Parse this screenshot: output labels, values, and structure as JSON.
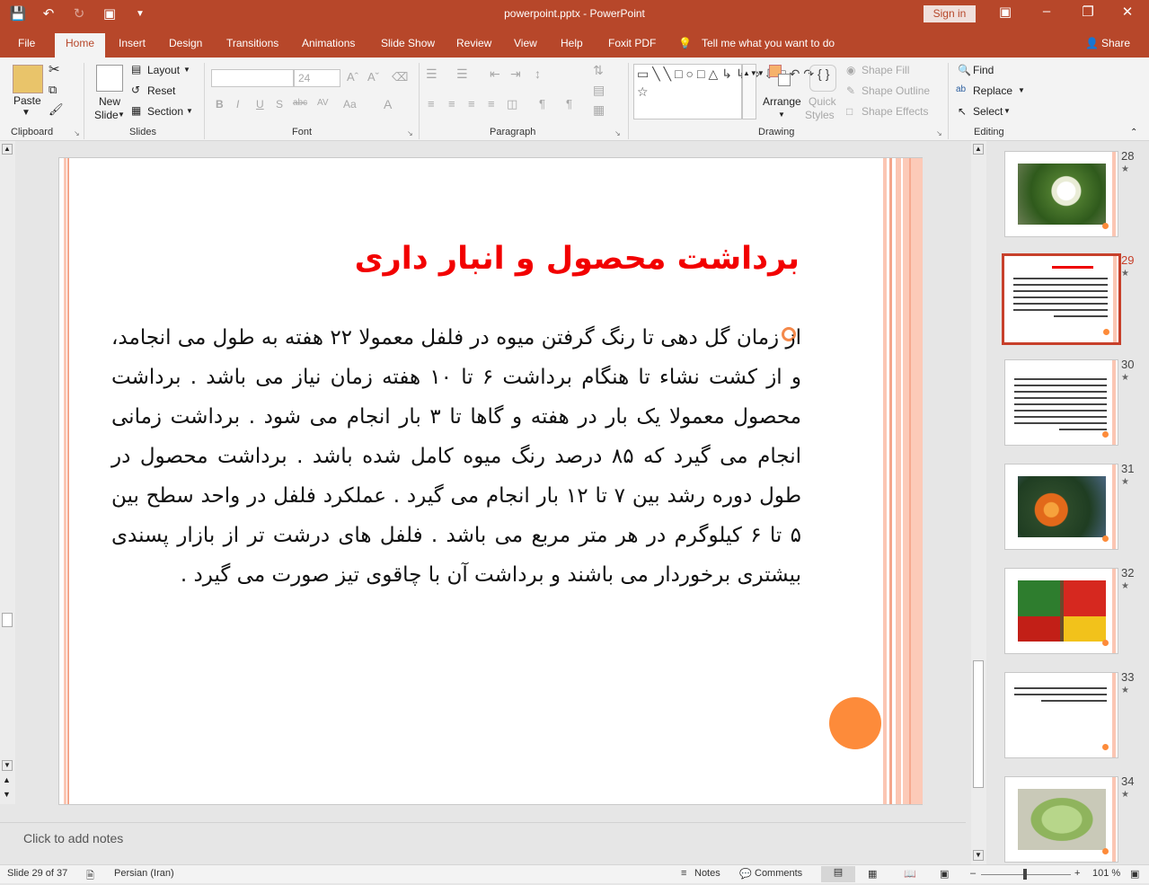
{
  "titlebar": {
    "title": "powerpoint.pptx - PowerPoint",
    "signin": "Sign in"
  },
  "tabs": [
    "File",
    "Home",
    "Insert",
    "Design",
    "Transitions",
    "Animations",
    "Slide Show",
    "Review",
    "View",
    "Help",
    "Foxit PDF",
    "Tell me what you want to do",
    "Share"
  ],
  "ribbon": {
    "paste": "Paste",
    "new_slide": "New",
    "new_slide2": "Slide",
    "layout": "Layout",
    "reset": "Reset",
    "section": "Section",
    "font_size": "24",
    "arrange": "Arrange",
    "quick_styles": "Quick",
    "quick_styles2": "Styles",
    "shape_fill": "Shape Fill",
    "shape_outline": "Shape Outline",
    "shape_effects": "Shape Effects",
    "find": "Find",
    "replace": "Replace",
    "select": "Select",
    "groups": [
      "Clipboard",
      "Slides",
      "Font",
      "Paragraph",
      "Drawing",
      "Editing"
    ]
  },
  "slide": {
    "heading": "برداشت محصول و انبار داری",
    "body": "از زمان گل دهی تا رنگ گرفتن میوه در فلفل معمولا ۲۲ هفته به طول می انجامد، و از کشت نشاء تا هنگام برداشت ۶ تا ۱۰ هفته زمان نیاز می باشد . برداشت محصول معمولا یک بار در هفته و گاها تا ۳ بار انجام می شود . برداشت زمانی انجام می گیرد که ۸۵ درصد رنگ میوه کامل شده باشد . برداشت محصول در طول دوره رشد بین ۷ تا ۱۲ بار انجام می گیرد . عملکرد فلفل در واحد سطح بین ۵ تا ۶ کیلوگرم در هر متر مربع می باشد . فلفل های درشت تر از بازار پسندی بیشتری برخوردار می باشند و برداشت آن با چاقوی تیز صورت می گیرد ."
  },
  "notes": "Click to add notes",
  "thumbs": [
    "28",
    "29",
    "30",
    "31",
    "32",
    "33",
    "34"
  ],
  "status": {
    "slide": "Slide 29 of 37",
    "lang": "Persian (Iran)",
    "notes": "Notes",
    "comments": "Comments",
    "zoom": "101 %"
  },
  "colors": {
    "accent": "#b7472a",
    "title_red": "#f20000",
    "orange": "#fd8b3a",
    "stripe": "#fbc6b3"
  }
}
